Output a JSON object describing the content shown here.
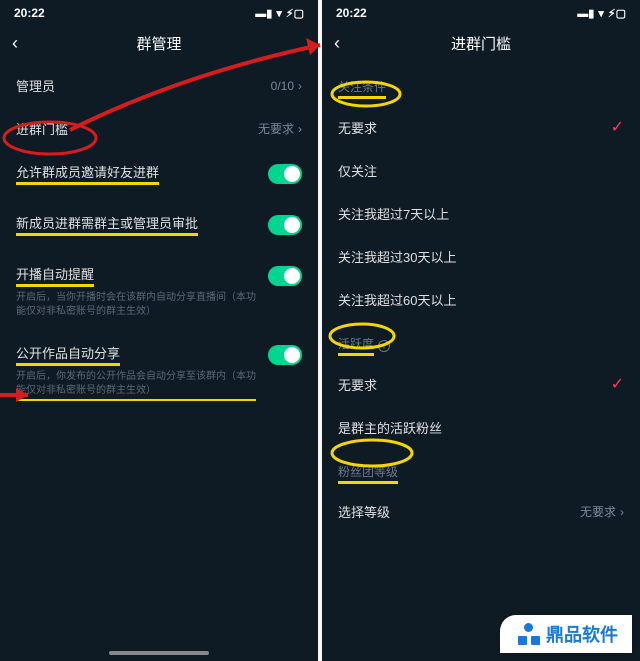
{
  "status": {
    "time": "20:22"
  },
  "left": {
    "title": "群管理",
    "admin": {
      "label": "管理员",
      "value": "0/10"
    },
    "threshold": {
      "label": "进群门槛",
      "value": "无要求"
    },
    "invite": {
      "label": "允许群成员邀请好友进群"
    },
    "approve": {
      "label": "新成员进群需群主或管理员审批"
    },
    "live_remind": {
      "label": "开播自动提醒",
      "desc": "开启后，当你开播时会在该群内自动分享直播间（本功能仅对非私密账号的群主生效）"
    },
    "auto_share": {
      "label": "公开作品自动分享",
      "desc": "开启后，你发布的公开作品会自动分享至该群内（本功能仅对非私密账号的群主生效）"
    }
  },
  "right": {
    "title": "进群门槛",
    "section_follow": "关注条件",
    "opts": {
      "none": "无要求",
      "only_follow": "仅关注",
      "days7": "关注我超过7天以上",
      "days30": "关注我超过30天以上",
      "days60": "关注我超过60天以上"
    },
    "section_active": "活跃度",
    "active_none": "无要求",
    "active_fan": "是群主的活跃粉丝",
    "section_level": "粉丝团等级",
    "level_select": {
      "label": "选择等级",
      "value": "无要求"
    }
  },
  "watermark": "鼎品软件"
}
